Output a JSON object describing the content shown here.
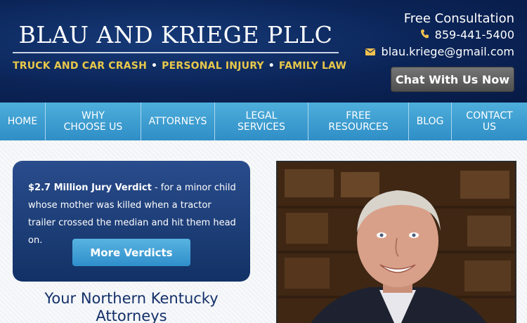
{
  "header": {
    "firm_name": "BLAU AND KRIEGE PLLC",
    "practice_areas": [
      "TRUCK AND CAR CRASH",
      "PERSONAL INJURY",
      "FAMILY LAW"
    ],
    "consultation_label": "Free Consultation",
    "phone": "859-441-5400",
    "email": "blau.kriege@gmail.com",
    "chat_button": "Chat With Us Now"
  },
  "nav": {
    "items": [
      "HOME",
      "WHY\nCHOOSE US",
      "ATTORNEYS",
      "LEGAL\nSERVICES",
      "FREE\nRESOURCES",
      "BLOG",
      "CONTACT\nUS"
    ]
  },
  "verdict": {
    "headline": "$2.7 Million Jury Verdict",
    "description": " - for a minor child whose mother was killed when a tractor trailer crossed the median and hit them head on.",
    "button": "More Verdicts"
  },
  "main": {
    "title": "Your Northern Kentucky Attorneys"
  },
  "colors": {
    "header_bg": "#0b2457",
    "nav_bg": "#3b9fd3",
    "accent_gold": "#e8c84a",
    "verdict_bg": "#1a3d78"
  },
  "icons": {
    "phone": "phone-icon",
    "email": "envelope-icon"
  }
}
